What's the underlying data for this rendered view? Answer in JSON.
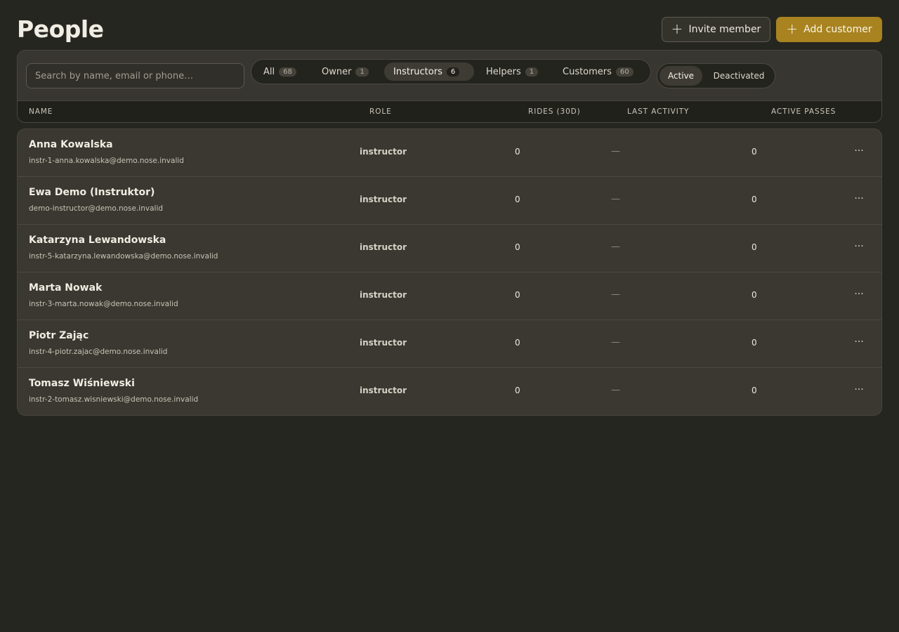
{
  "header": {
    "title": "People",
    "invite_label": "Invite member",
    "add_label": "Add customer",
    "plus_glyph": "+"
  },
  "search": {
    "placeholder": "Search by name, email or phone…",
    "value": ""
  },
  "tabs": [
    {
      "label": "All",
      "count": "68",
      "active": false
    },
    {
      "label": "Owner",
      "count": "1",
      "active": false
    },
    {
      "label": "Instructors",
      "count": "6",
      "active": true
    },
    {
      "label": "Helpers",
      "count": "1",
      "active": false
    },
    {
      "label": "Customers",
      "count": "60",
      "active": false
    }
  ],
  "status_filter": {
    "active_label": "Active",
    "deactivated_label": "Deactivated",
    "selected": "Active"
  },
  "columns": {
    "name": "NAME",
    "role": "ROLE",
    "rides": "RIDES (30D)",
    "last_activity": "LAST ACTIVITY",
    "active_passes": "ACTIVE PASSES"
  },
  "rows": [
    {
      "name": "Anna Kowalska",
      "email": "instr-1-anna.kowalska@demo.nose.invalid",
      "role": "instructor",
      "rides": "0",
      "last_activity": "—",
      "passes": "0"
    },
    {
      "name": "Ewa Demo (Instruktor)",
      "email": "demo-instructor@demo.nose.invalid",
      "role": "instructor",
      "rides": "0",
      "last_activity": "—",
      "passes": "0"
    },
    {
      "name": "Katarzyna Lewandowska",
      "email": "instr-5-katarzyna.lewandowska@demo.nose.invalid",
      "role": "instructor",
      "rides": "0",
      "last_activity": "—",
      "passes": "0"
    },
    {
      "name": "Marta Nowak",
      "email": "instr-3-marta.nowak@demo.nose.invalid",
      "role": "instructor",
      "rides": "0",
      "last_activity": "—",
      "passes": "0"
    },
    {
      "name": "Piotr Zając",
      "email": "instr-4-piotr.zajac@demo.nose.invalid",
      "role": "instructor",
      "rides": "0",
      "last_activity": "—",
      "passes": "0"
    },
    {
      "name": "Tomasz Wiśniewski",
      "email": "instr-2-tomasz.wisniewski@demo.nose.invalid",
      "role": "instructor",
      "rides": "0",
      "last_activity": "—",
      "passes": "0"
    }
  ],
  "row_menu_glyph": "···",
  "colors": {
    "background": "#262621",
    "accent": "#a8831f",
    "panel": "#383630"
  }
}
